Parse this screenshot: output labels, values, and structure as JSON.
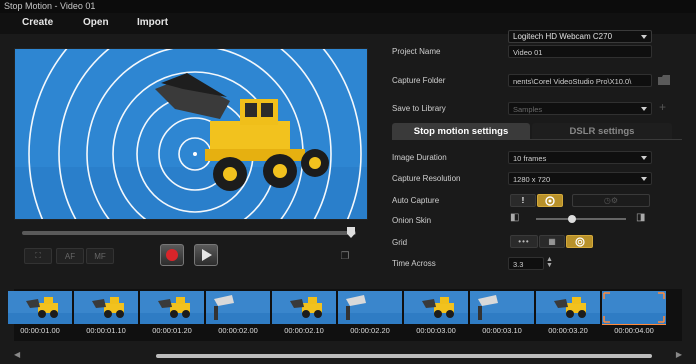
{
  "window": {
    "title": "Stop Motion - Video 01"
  },
  "menu": [
    {
      "label": "Create"
    },
    {
      "label": "Open"
    },
    {
      "label": "Import"
    }
  ],
  "camera": {
    "selected": "Logitech HD Webcam C270"
  },
  "settings": {
    "project_name": {
      "label": "Project Name",
      "value": "Video 01"
    },
    "capture_folder": {
      "label": "Capture Folder",
      "value": "nents\\Corel VideoStudio Pro\\X10.0\\"
    },
    "save_to_library": {
      "label": "Save to Library",
      "value": "Samples"
    },
    "tabs": [
      {
        "label": "Stop motion settings",
        "active": true
      },
      {
        "label": "DSLR settings",
        "active": false
      }
    ],
    "image_duration": {
      "label": "Image Duration",
      "value": "10 frames"
    },
    "capture_resolution": {
      "label": "Capture Resolution",
      "value": "1280 x 720"
    },
    "auto_capture": {
      "label": "Auto Capture"
    },
    "onion_skin": {
      "label": "Onion Skin",
      "level": 0.4
    },
    "grid": {
      "label": "Grid"
    },
    "time_across": {
      "label": "Time Across",
      "value": "3.3"
    }
  },
  "preview_controls": {
    "af_label": "AF",
    "mf_label": "MF"
  },
  "filmstrip": {
    "frames": [
      {
        "timecode": "00:00:01.00",
        "selected": false,
        "variant": "truck"
      },
      {
        "timecode": "00:00:01.10",
        "selected": false,
        "variant": "truck"
      },
      {
        "timecode": "00:00:01.20",
        "selected": false,
        "variant": "truck"
      },
      {
        "timecode": "00:00:02.00",
        "selected": false,
        "variant": "bucket"
      },
      {
        "timecode": "00:00:02.10",
        "selected": false,
        "variant": "truck"
      },
      {
        "timecode": "00:00:02.20",
        "selected": false,
        "variant": "bucket"
      },
      {
        "timecode": "00:00:03.00",
        "selected": false,
        "variant": "truck"
      },
      {
        "timecode": "00:00:03.10",
        "selected": false,
        "variant": "bucket"
      },
      {
        "timecode": "00:00:03.20",
        "selected": false,
        "variant": "truck"
      },
      {
        "timecode": "00:00:04.00",
        "selected": true,
        "variant": "empty"
      }
    ]
  },
  "colors": {
    "accent": "#b8912a",
    "sky": "#2e86d2",
    "record": "#d8252a",
    "selection": "#ff8a3c"
  }
}
